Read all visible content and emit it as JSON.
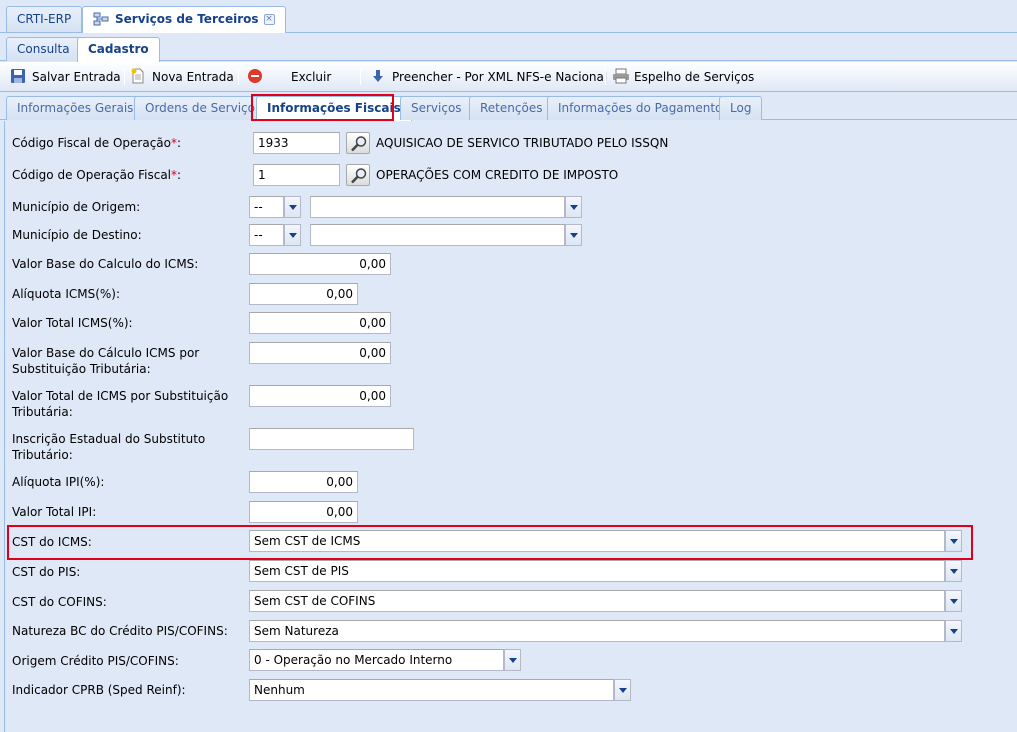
{
  "app_tabs": [
    {
      "label": "CRTI-ERP"
    },
    {
      "label": "Serviços de Terceiros"
    }
  ],
  "sub_tabs": [
    {
      "label": "Consulta"
    },
    {
      "label": "Cadastro"
    }
  ],
  "toolbar": {
    "save": "Salvar Entrada",
    "new": "Nova Entrada",
    "delete": "Excluir",
    "fill_xml": "Preencher - Por XML NFS-e Nacional",
    "mirror": "Espelho de Serviços"
  },
  "inner_tabs": [
    {
      "label": "Informações Gerais"
    },
    {
      "label": "Ordens de Serviço"
    },
    {
      "label": "Informações Fiscais"
    },
    {
      "label": "Serviços"
    },
    {
      "label": "Retenções"
    },
    {
      "label": "Informações do Pagamento"
    },
    {
      "label": "Log"
    }
  ],
  "form": {
    "cfop": {
      "label": "Código Fiscal de Operação",
      "required": "*",
      "suffix": ":",
      "value": "1933",
      "description": "AQUISICAO DE SERVICO TRIBUTADO PELO ISSQN"
    },
    "cof": {
      "label": "Código de Operação Fiscal",
      "required": "*",
      "suffix": ":",
      "value": "1",
      "description": "OPERAÇÕES COM CREDITO DE IMPOSTO"
    },
    "municipio_origem": {
      "label": "Município de Origem:",
      "uf": "--",
      "city": ""
    },
    "municipio_destino": {
      "label": "Município de Destino:",
      "uf": "--",
      "city": ""
    },
    "base_icms": {
      "label": "Valor Base do Calculo do ICMS:",
      "value": "0,00"
    },
    "aliquota_icms": {
      "label": "Alíquota ICMS(%):",
      "value": "0,00"
    },
    "total_icms": {
      "label": "Valor Total ICMS(%):",
      "value": "0,00"
    },
    "base_icms_st_l1": "Valor Base do Cálculo ICMS por",
    "base_icms_st_l2": "Substituição Tributária:",
    "base_icms_st_value": "0,00",
    "total_icms_st_l1": "Valor Total de ICMS por Substituição",
    "total_icms_st_l2": "Tributária:",
    "total_icms_st_value": "0,00",
    "ie_subst_l1": "Inscrição Estadual do Substituto",
    "ie_subst_l2": "Tributário:",
    "ie_subst_value": "",
    "aliquota_ipi": {
      "label": "Alíquota IPI(%):",
      "value": "0,00"
    },
    "total_ipi": {
      "label": "Valor Total IPI:",
      "value": "0,00"
    },
    "cst_icms": {
      "label": "CST do ICMS:",
      "value": "Sem CST de ICMS"
    },
    "cst_pis": {
      "label": "CST do PIS:",
      "value": "Sem CST de PIS"
    },
    "cst_cofins": {
      "label": "CST do COFINS:",
      "value": "Sem CST de COFINS"
    },
    "natureza_bc": {
      "label": "Natureza BC do Crédito PIS/COFINS:",
      "value": "Sem Natureza"
    },
    "origem_credito": {
      "label": "Origem Crédito PIS/COFINS:",
      "value": "0 - Operação no Mercado Interno"
    },
    "indicador_cprb": {
      "label": "Indicador CPRB (Sped Reinf):",
      "value": "Nenhum"
    }
  },
  "colors": {
    "highlight": "#e0001b",
    "tab_text": "#15428b",
    "panel_bg": "#dfe8f6"
  }
}
